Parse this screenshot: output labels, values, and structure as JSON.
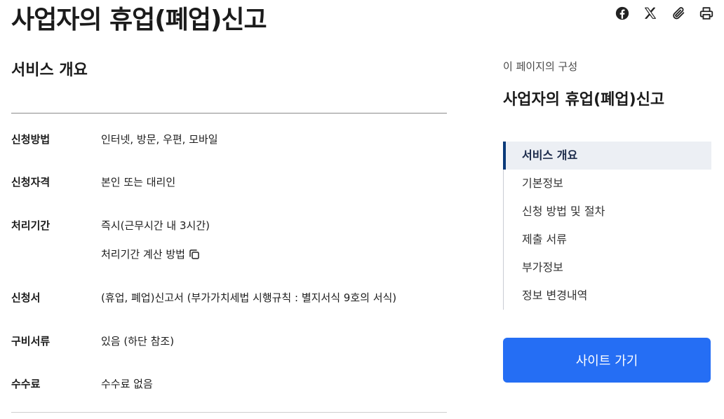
{
  "page": {
    "title": "사업자의 휴업(폐업)신고"
  },
  "share": {
    "items": [
      {
        "name": "facebook-icon",
        "icon": "facebook"
      },
      {
        "name": "x-icon",
        "icon": "x"
      },
      {
        "name": "link-icon",
        "icon": "paperclip"
      },
      {
        "name": "print-icon",
        "icon": "printer"
      }
    ]
  },
  "overview": {
    "heading": "서비스 개요",
    "rows": [
      {
        "label": "신청방법",
        "value": "인터넷, 방문, 우편, 모바일"
      },
      {
        "label": "신청자격",
        "value": "본인 또는 대리인"
      },
      {
        "label": "처리기간",
        "value": "즉시(근무시간 내 3시간)",
        "sub": "처리기간 계산 방법"
      },
      {
        "label": "신청서",
        "value": "(휴업, 폐업)신고서 (부가가치세법 시행규칙 : 별지서식 9호의 서식)"
      },
      {
        "label": "구비서류",
        "value": "있음 (하단 참조)"
      },
      {
        "label": "수수료",
        "value": "수수료 없음"
      }
    ]
  },
  "toc": {
    "caption": "이 페이지의 구성",
    "title": "사업자의 휴업(폐업)신고",
    "items": [
      {
        "label": "서비스 개요",
        "active": true
      },
      {
        "label": "기본정보",
        "active": false
      },
      {
        "label": "신청 방법 및 절차",
        "active": false
      },
      {
        "label": "제출 서류",
        "active": false
      },
      {
        "label": "부가정보",
        "active": false
      },
      {
        "label": "정보 변경내역",
        "active": false
      }
    ]
  },
  "actions": {
    "site_button": "사이트 가기"
  },
  "colors": {
    "accent": "#256ef4",
    "toc_active_bar": "#0b3a7a",
    "toc_active_bg": "#eceff4"
  }
}
